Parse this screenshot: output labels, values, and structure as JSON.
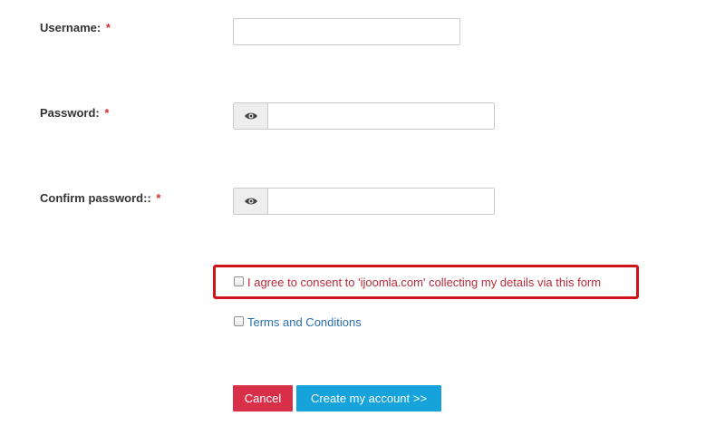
{
  "form": {
    "username": {
      "label": "Username:",
      "required_mark": "*",
      "value": ""
    },
    "password": {
      "label": "Password:",
      "required_mark": "*",
      "value": ""
    },
    "confirm_password": {
      "label": "Confirm password::",
      "required_mark": "*",
      "value": ""
    },
    "consent": {
      "checked": false,
      "text": "I agree to consent to 'ijoomla.com' collecting my details via this form"
    },
    "terms": {
      "checked": false,
      "link_text": "Terms and Conditions"
    },
    "buttons": {
      "cancel": "Cancel",
      "create": "Create my account >>"
    }
  },
  "icons": {
    "password_toggle": "eye-icon"
  },
  "colors": {
    "required": "#c9302c",
    "consent_text": "#b52b3a",
    "consent_highlight_border": "#d0121b",
    "link": "#2a6fb0",
    "cancel_button": "#d9304a",
    "create_button": "#16a3dc"
  }
}
